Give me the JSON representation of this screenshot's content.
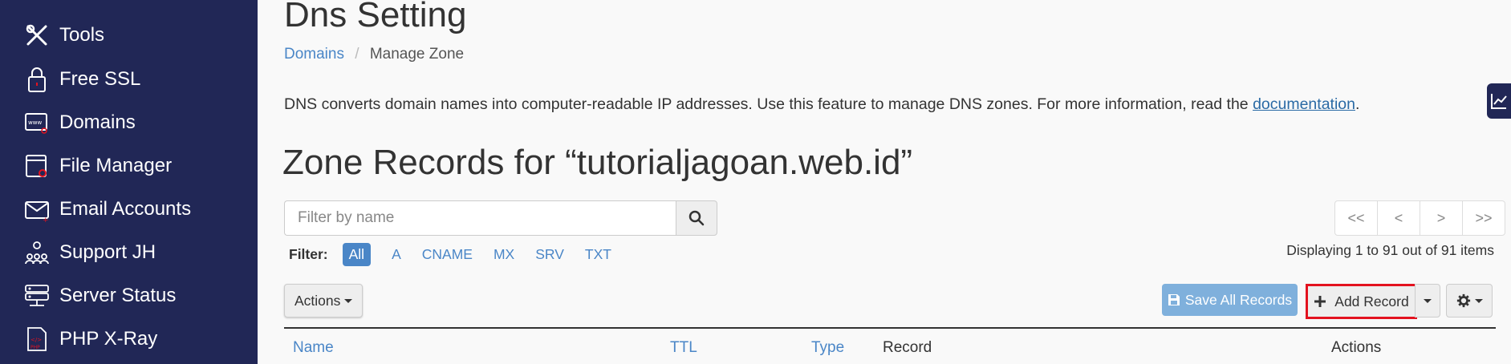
{
  "sidebar": {
    "items": [
      {
        "label": "Tools",
        "icon": "tools-icon"
      },
      {
        "label": "Free SSL",
        "icon": "lock-icon"
      },
      {
        "label": "Domains",
        "icon": "domains-icon"
      },
      {
        "label": "File Manager",
        "icon": "file-manager-icon"
      },
      {
        "label": "Email Accounts",
        "icon": "email-icon"
      },
      {
        "label": "Support JH",
        "icon": "support-icon"
      },
      {
        "label": "Server Status",
        "icon": "server-icon"
      },
      {
        "label": "PHP X-Ray",
        "icon": "php-icon"
      }
    ]
  },
  "page": {
    "title": "Dns Setting",
    "breadcrumb": {
      "parent": "Domains",
      "separator": "/",
      "current": "Manage Zone"
    },
    "description": "DNS converts domain names into computer-readable IP addresses. Use this feature to manage DNS zones. For more information, read the ",
    "description_link": "documentation",
    "description_end": ".",
    "zone_title": "Zone Records for “tutorialjagoan.web.id”"
  },
  "search": {
    "placeholder": "Filter by name"
  },
  "filter": {
    "label": "Filter:",
    "options": [
      "All",
      "A",
      "CNAME",
      "MX",
      "SRV",
      "TXT"
    ],
    "selected": "All"
  },
  "pagination": {
    "first": "<<",
    "prev": "<",
    "next": ">",
    "last": ">>",
    "status": "Displaying 1 to 91 out of 91 items"
  },
  "toolbar": {
    "actions_label": "Actions",
    "save_all_label": "Save All Records",
    "add_record_label": "Add Record"
  },
  "table": {
    "columns": [
      "Name",
      "TTL",
      "Type",
      "Record",
      "Actions"
    ]
  },
  "colors": {
    "sidebar_bg": "#212756",
    "link": "#4a86c7",
    "highlight": "#e3121f",
    "save_btn": "#7fb0dc"
  }
}
